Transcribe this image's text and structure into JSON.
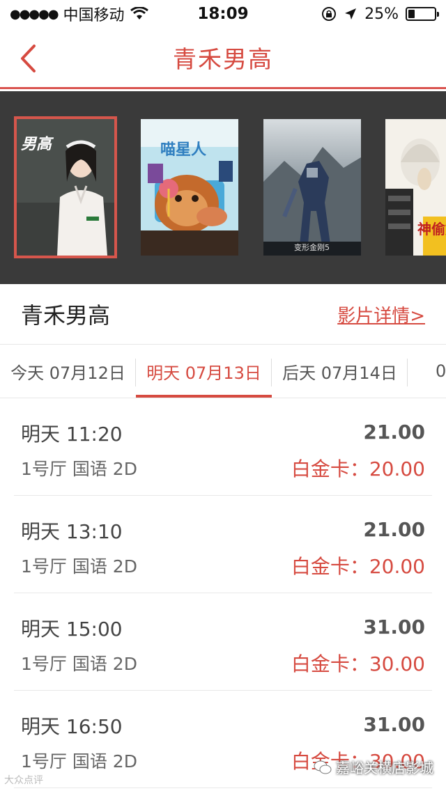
{
  "status_bar": {
    "carrier": "中国移动",
    "time": "18:09",
    "battery": "25%",
    "battery_level": 0.25,
    "icons": [
      "signal-dots-icon",
      "wifi-icon",
      "rotation-lock-icon",
      "location-arrow-icon",
      "battery-icon"
    ]
  },
  "nav": {
    "title": "青禾男高",
    "back_icon": "chevron-left-icon"
  },
  "posters": [
    {
      "name": "poster-qinghe-nangao",
      "title": "男高",
      "selected": true
    },
    {
      "name": "poster-miao-xing-ren",
      "title": "喵星人",
      "selected": false
    },
    {
      "name": "poster-transformers",
      "title": "变形金刚5",
      "selected": false
    },
    {
      "name": "poster-despicable-me",
      "title": "神偷奶爸",
      "selected": false
    }
  ],
  "movie": {
    "title": "青禾男高",
    "detail_link": "影片详情>"
  },
  "date_tabs": [
    {
      "label": "今天 07月12日",
      "active": false
    },
    {
      "label": "明天 07月13日",
      "active": true
    },
    {
      "label": "后天 07月14日",
      "active": false
    },
    {
      "label": "0",
      "active": false
    }
  ],
  "showtimes": [
    {
      "time": "明天 11:20",
      "hall": "1号厅 国语 2D",
      "price": "21.00",
      "member_price": "白金卡：20.00"
    },
    {
      "time": "明天 13:10",
      "hall": "1号厅 国语 2D",
      "price": "21.00",
      "member_price": "白金卡：20.00"
    },
    {
      "time": "明天 15:00",
      "hall": "1号厅 国语 2D",
      "price": "31.00",
      "member_price": "白金卡：30.00"
    },
    {
      "time": "明天 16:50",
      "hall": "1号厅 国语 2D",
      "price": "31.00",
      "member_price": "白金卡：30.00"
    }
  ],
  "watermarks": {
    "left": "大众点评",
    "right": "嘉峪关横店影城"
  },
  "colors": {
    "accent": "#d64a40",
    "strip_bg": "#3a3a3a"
  }
}
